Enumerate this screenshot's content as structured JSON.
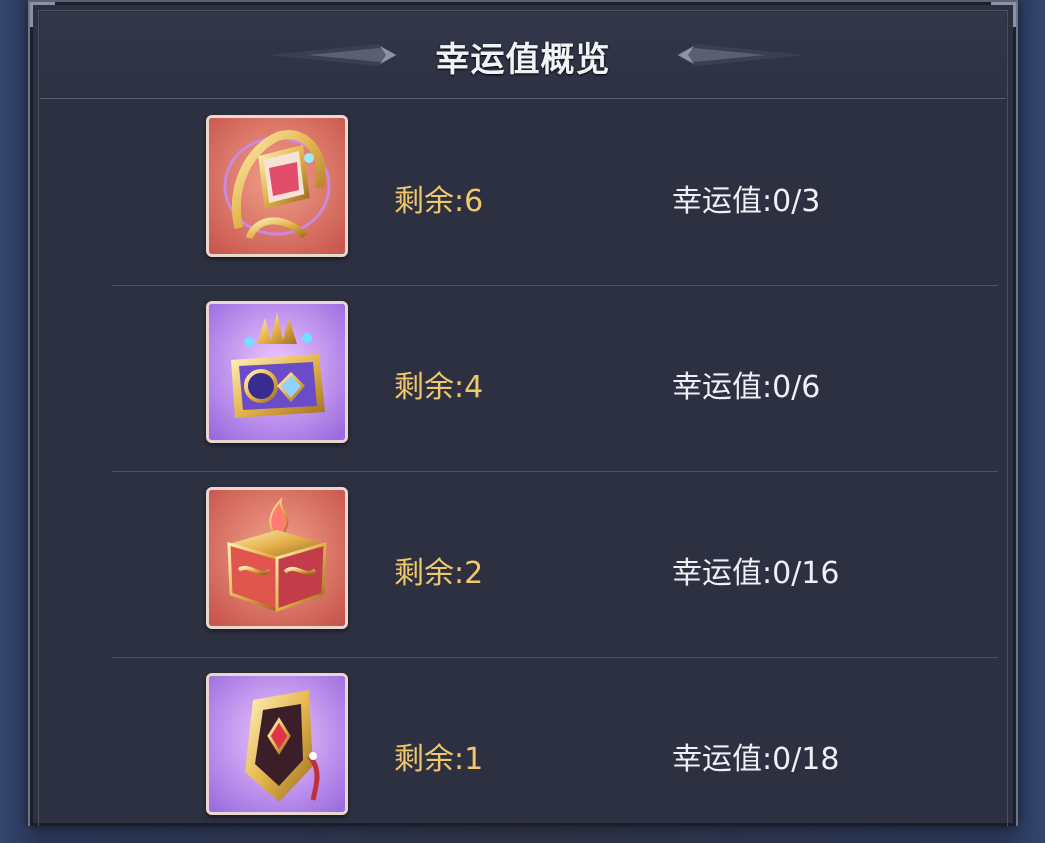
{
  "window": {
    "title": "幸运值概览"
  },
  "items": [
    {
      "icon": "golden-ornament-pendant-icon",
      "frame_color": "#d86a5f",
      "remaining_label": "剩余:6",
      "luck_label": "幸运值:0/3"
    },
    {
      "icon": "purple-crown-chest-icon",
      "frame_color": "#b48ae6",
      "remaining_label": "剩余:4",
      "luck_label": "幸运值:0/6"
    },
    {
      "icon": "red-flame-chest-icon",
      "frame_color": "#d86a5f",
      "remaining_label": "剩余:2",
      "luck_label": "幸运值:0/16"
    },
    {
      "icon": "golden-shield-tassel-icon",
      "frame_color": "#b48ae6",
      "remaining_label": "剩余:1",
      "luck_label": "幸运值:0/18"
    }
  ],
  "colors": {
    "remaining_text": "#efc76c",
    "luck_text": "#eef0f6",
    "panel_bg": "#2d3040"
  }
}
